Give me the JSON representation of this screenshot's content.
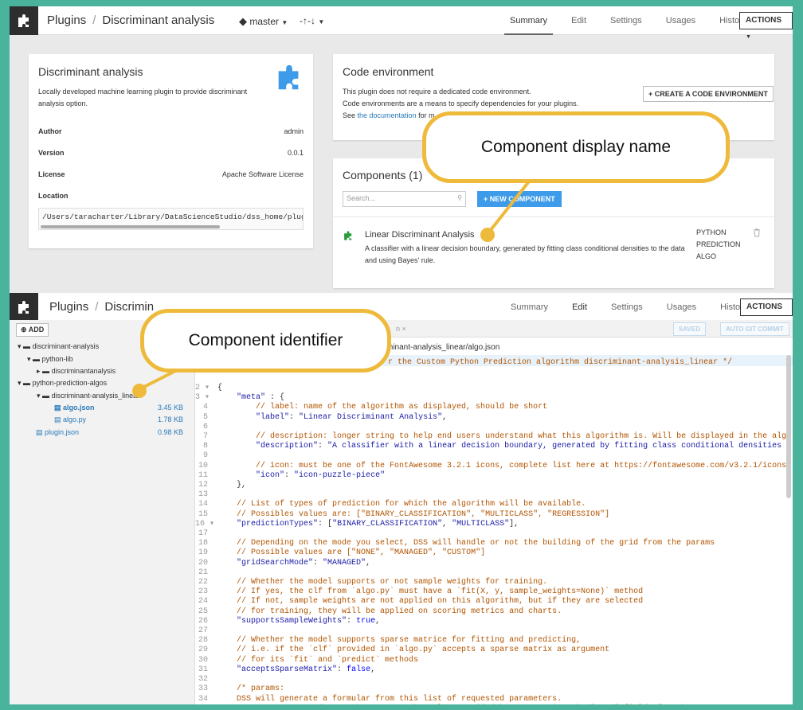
{
  "top": {
    "nav": {
      "crumb_plugins": "Plugins",
      "crumb_sep": "/",
      "crumb_name": "Discriminant analysis",
      "branch": "master",
      "sync": "-↑-↓",
      "tabs": [
        "Summary",
        "Edit",
        "Settings",
        "Usages",
        "History"
      ],
      "active_tab": "Summary",
      "actions": "ACTIONS"
    },
    "info": {
      "title": "Discriminant analysis",
      "description": "Locally developed machine learning plugin to provide discriminant analysis option.",
      "rows": [
        {
          "label": "Author",
          "value": "admin"
        },
        {
          "label": "Version",
          "value": "0.0.1"
        },
        {
          "label": "License",
          "value": "Apache Software License"
        }
      ],
      "location_label": "Location",
      "location_value": "/Users/taracharter/Library/DataScienceStudio/dss_home/plugi"
    },
    "code_env": {
      "title": "Code environment",
      "line1": "This plugin does not require a dedicated code environment.",
      "line2": "Code environments are a means to specify dependencies for your plugins.",
      "line3_prefix": "See ",
      "line3_link": "the documentation",
      "line3_suffix": " for m",
      "create_button": "+ CREATE A CODE ENVIRONMENT"
    },
    "components": {
      "title": "Components (1)",
      "search_placeholder": "Search...",
      "new_button": "+ NEW COMPONENT",
      "item_name": "Linear Discriminant Analysis",
      "item_desc": "A classifier with a linear decision boundary, generated by fitting class conditional densities to the data and using Bayes' rule.",
      "item_type_1": "PYTHON",
      "item_type_2": "PREDICTION",
      "item_type_3": "ALGO"
    },
    "callout": "Component display name"
  },
  "bottom": {
    "nav": {
      "crumb_plugins": "Plugins",
      "crumb_sep": "/",
      "crumb_name": "Discrimin",
      "tabs": [
        "Summary",
        "Edit",
        "Settings",
        "Usages",
        "History"
      ],
      "active_tab": "Edit",
      "actions": "ACTIONS"
    },
    "add_button": "ADD",
    "tab_fragment": "n",
    "saved_button": "SAVED",
    "git_button": "AUTO GIT COMMIT",
    "path_fragment": "minant-analysis_linear/algo.json",
    "tree": [
      {
        "label": "discriminant-analysis",
        "size": ""
      },
      {
        "label": "python-lib",
        "size": ""
      },
      {
        "label": "discriminantanalysis",
        "size": ""
      },
      {
        "label": "python-prediction-algos",
        "size": ""
      },
      {
        "label": "discriminant-analysis_linear",
        "size": ""
      },
      {
        "label": "algo.json",
        "size": "3.45 KB"
      },
      {
        "label": "algo.py",
        "size": "1.78 KB"
      },
      {
        "label": "plugin.json",
        "size": "0.98 KB"
      }
    ],
    "code_line_1": "r the Custom Python Prediction algorithm discriminant-analysis_linear */",
    "callout": "Component identifier"
  },
  "colors": {
    "accent": "#3d9be9",
    "callout_border": "#eeba3b",
    "background": "#4ab39c"
  },
  "icons": [
    "puzzle-icon",
    "branch-icon",
    "search-icon",
    "trash-icon",
    "folder-icon",
    "file-icon",
    "plus-icon"
  ]
}
